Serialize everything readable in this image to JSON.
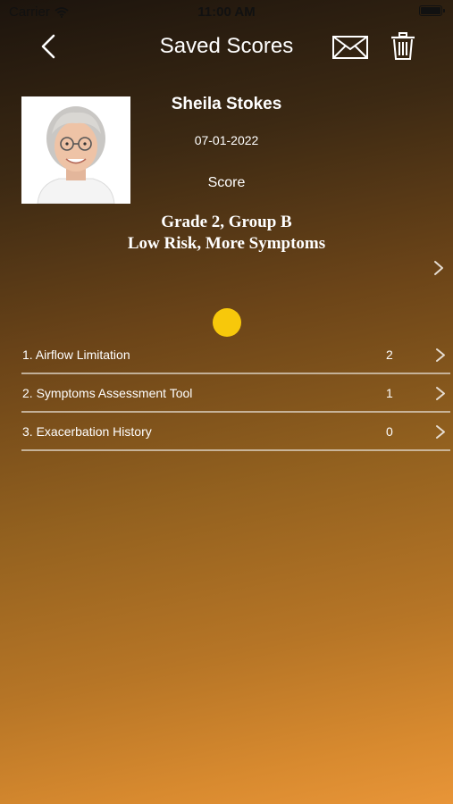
{
  "status_bar": {
    "carrier": "Carrier",
    "time": "11:00 AM"
  },
  "nav": {
    "title": "Saved Scores",
    "icons": [
      "chevron-left-icon",
      "envelope-icon",
      "trash-icon"
    ]
  },
  "patient": {
    "name": "Sheila Stokes",
    "date": "07-01-2022",
    "score_label": "Score",
    "grade": "Grade 2, Group B",
    "risk": "Low Risk, More Symptoms"
  },
  "indicator_color": "#f7c80b",
  "items": [
    {
      "label": "1. Airflow Limitation",
      "value": "2"
    },
    {
      "label": "2. Symptoms Assessment Tool",
      "value": "1"
    },
    {
      "label": "3. Exacerbation History",
      "value": "0"
    }
  ]
}
